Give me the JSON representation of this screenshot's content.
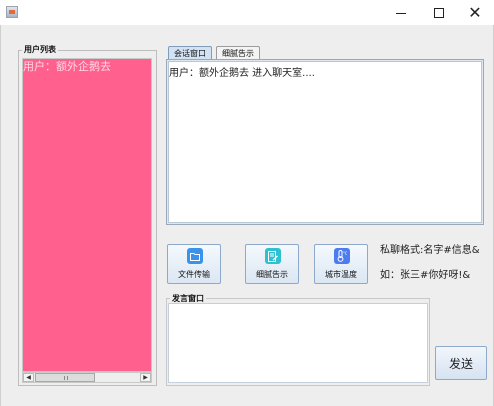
{
  "window": {
    "minimize_glyph": "",
    "close_glyph": "✕"
  },
  "user_list": {
    "title": "用户列表",
    "items": [
      "用户：额外企鹅去"
    ]
  },
  "tabs": [
    {
      "label": "会话窗口",
      "selected": true
    },
    {
      "label": "细腻告示",
      "selected": false
    }
  ],
  "chat": {
    "messages": [
      "用户：额外企鹅去 进入聊天室...."
    ]
  },
  "toolbar": {
    "file_transfer_label": "文件传输",
    "news_label": "细腻告示",
    "weather_label": "城市温度"
  },
  "hint": {
    "format": "私聊格式:名字#信息&",
    "example": "如：张三#你好呀!&"
  },
  "input": {
    "title": "发言窗口",
    "value": ""
  },
  "send_label": "发送",
  "colors": {
    "user_list_bg": "#ff608d",
    "selected_tab": "#d3e2f3"
  },
  "icons": [
    "java-app-icon",
    "minimize-icon",
    "maximize-icon",
    "close-icon",
    "folder-icon",
    "document-edit-icon",
    "thermometer-icon"
  ]
}
